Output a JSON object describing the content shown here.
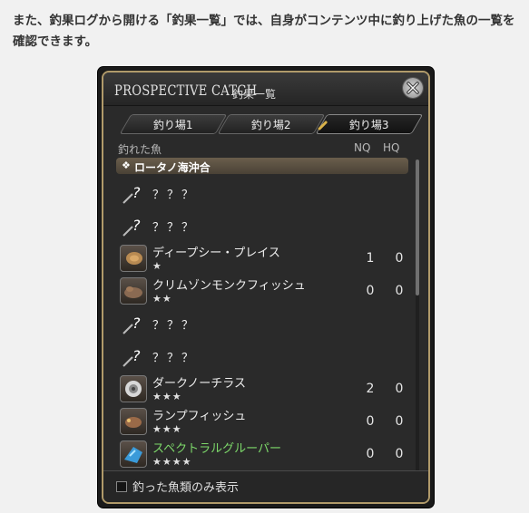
{
  "caption": {
    "text": "また、釣果ログから開ける「釣果一覧」では、自身がコンテンツ中に釣り上げた魚の一覧を確認できます。"
  },
  "window": {
    "title_en": "PROSPECTIVE CATCH",
    "title_jp": "釣果一覧",
    "close_icon": "close-icon"
  },
  "tabs": [
    {
      "label": "釣り場1"
    },
    {
      "label": "釣り場2"
    },
    {
      "label": "釣り場3",
      "active": true
    }
  ],
  "columns": {
    "fish": "釣れた魚",
    "nq": "NQ",
    "hq": "HQ"
  },
  "region": {
    "icon": "❖",
    "label": "ロータノ海沖合"
  },
  "fish": [
    {
      "name": "？？？",
      "stars": "",
      "nq": "",
      "hq": "",
      "known": false
    },
    {
      "name": "？？？",
      "stars": "",
      "nq": "",
      "hq": "",
      "known": false
    },
    {
      "name": "ディープシー・プレイス",
      "stars": "★",
      "nq": "1",
      "hq": "0",
      "known": true
    },
    {
      "name": "クリムゾンモンクフィッシュ",
      "stars": "★★",
      "nq": "0",
      "hq": "0",
      "known": true
    },
    {
      "name": "？？？",
      "stars": "",
      "nq": "",
      "hq": "",
      "known": false
    },
    {
      "name": "？？？",
      "stars": "",
      "nq": "",
      "hq": "",
      "known": false
    },
    {
      "name": "ダークノーチラス",
      "stars": "★★★",
      "nq": "2",
      "hq": "0",
      "known": true
    },
    {
      "name": "ランプフィッシュ",
      "stars": "★★★",
      "nq": "0",
      "hq": "0",
      "known": true
    },
    {
      "name": "スペクトラルグルーパー",
      "stars": "★★★★",
      "nq": "0",
      "hq": "0",
      "known": true,
      "rare": true
    }
  ],
  "footer": {
    "checkbox_label": "釣った魚類のみ表示",
    "checked": false
  },
  "colors": {
    "frame": "#b09a6a",
    "rare_name": "#7dd96a",
    "panel_bg": "#2a2a2a"
  }
}
